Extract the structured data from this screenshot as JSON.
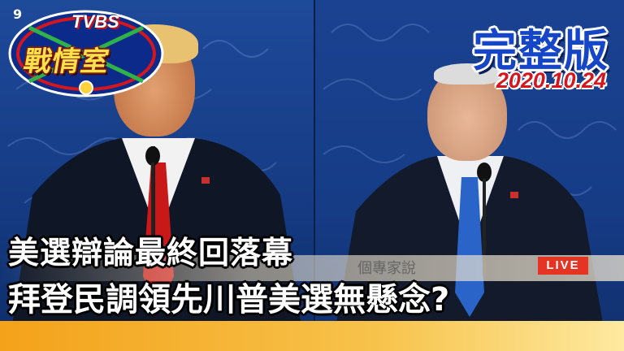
{
  "logo": {
    "channel_number": "9",
    "brand": "TVBS",
    "program_name": "戰情室"
  },
  "badge": {
    "title": "完整版",
    "date": "2020.10.24"
  },
  "live_tag": "LIVE",
  "ticker_partial": "個專家說",
  "headline": {
    "line1": "美選辯論最終回落幕",
    "line2": "拜登民調領先川普美選無懸念?"
  },
  "colors": {
    "backdrop_blue": "#1b4592",
    "title_blue": "#1646c8",
    "date_red": "#d4161e",
    "live_red": "#e53424",
    "band_orange": "#f4a21a"
  }
}
